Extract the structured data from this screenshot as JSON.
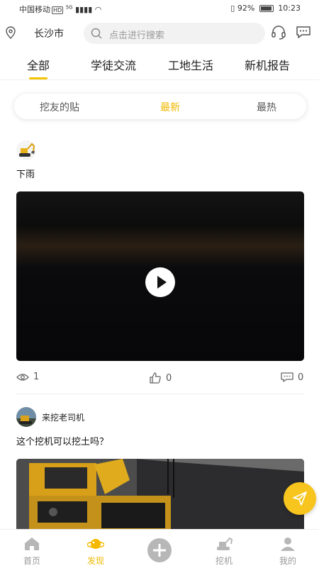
{
  "status_bar": {
    "carrier": "中国移动",
    "hd": "HD",
    "network": "5G",
    "battery": "92%",
    "battery_level": 0.92,
    "time": "10:23"
  },
  "header": {
    "city": "长沙市",
    "search_placeholder": "点击进行搜索"
  },
  "tabs": [
    {
      "label": "全部",
      "active": true
    },
    {
      "label": "学徒交流"
    },
    {
      "label": "工地生活"
    },
    {
      "label": "新机报告"
    }
  ],
  "subtabs": [
    {
      "label": "挖友的贴"
    },
    {
      "label": "最新",
      "active": true
    },
    {
      "label": "最热"
    }
  ],
  "posts": [
    {
      "author": "",
      "text": "下雨",
      "media": "video",
      "views": "1",
      "likes": "0",
      "comments": "0"
    },
    {
      "author": "来挖老司机",
      "text": "这个挖机可以挖土吗？",
      "media": "image"
    }
  ],
  "bottom_nav": [
    {
      "label": "首页",
      "icon": "home-icon"
    },
    {
      "label": "发现",
      "icon": "planet-icon",
      "active": true
    },
    {
      "label": "",
      "icon": "plus-icon"
    },
    {
      "label": "挖机",
      "icon": "excavator-icon"
    },
    {
      "label": "我的",
      "icon": "user-icon"
    }
  ],
  "colors": {
    "accent": "#f5c400",
    "fab": "#f7c51d"
  }
}
